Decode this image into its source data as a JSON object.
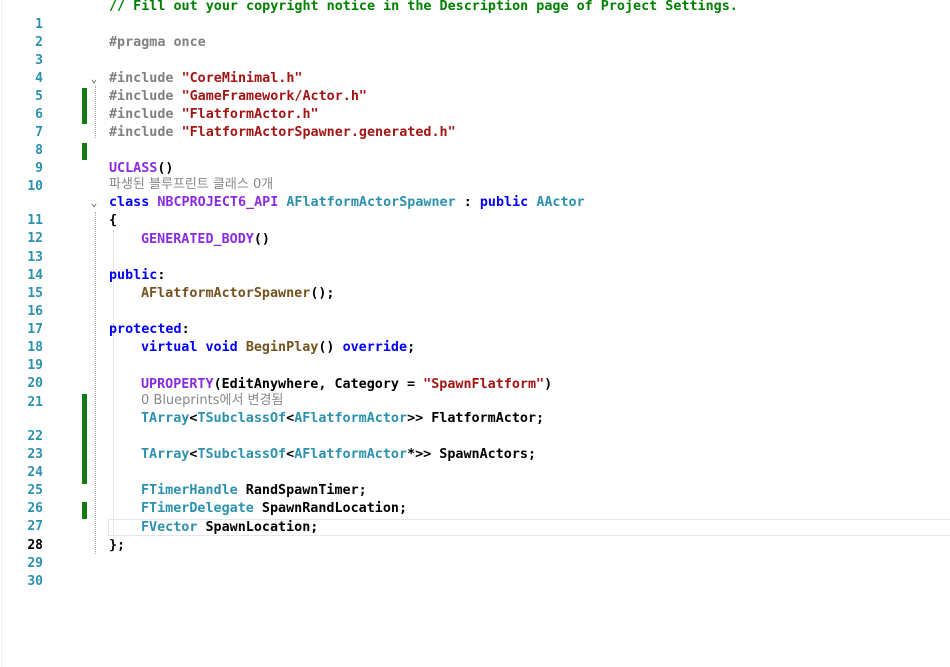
{
  "editor": {
    "lines": [
      {
        "n": "1"
      },
      {
        "n": "2"
      },
      {
        "n": "3"
      },
      {
        "n": "4"
      },
      {
        "n": "5"
      },
      {
        "n": "6"
      },
      {
        "n": "7"
      },
      {
        "n": "8"
      },
      {
        "n": "9"
      },
      {
        "n": "10"
      },
      {
        "n": "11"
      },
      {
        "n": "12"
      },
      {
        "n": "13"
      },
      {
        "n": "14"
      },
      {
        "n": "15"
      },
      {
        "n": "16"
      },
      {
        "n": "17"
      },
      {
        "n": "18"
      },
      {
        "n": "19"
      },
      {
        "n": "20"
      },
      {
        "n": "21"
      },
      {
        "n": "22"
      },
      {
        "n": "23"
      },
      {
        "n": "24"
      },
      {
        "n": "25"
      },
      {
        "n": "26"
      },
      {
        "n": "27"
      },
      {
        "n": "28"
      },
      {
        "n": "29"
      },
      {
        "n": "30"
      }
    ],
    "code": {
      "l1": "// Fill out your copyright notice in the Description page of Project Settings.",
      "l3": "#pragma once",
      "l5_dir": "#include ",
      "l5_str": "\"CoreMinimal.h\"",
      "l6_dir": "#include ",
      "l6_str": "\"GameFramework/Actor.h\"",
      "l7_dir": "#include ",
      "l7_str": "\"FlatformActor.h\"",
      "l8_dir": "#include ",
      "l8_str": "\"FlatformActorSpawner.generated.h\"",
      "l10_mac": "UCLASS",
      "l10_p": "()",
      "hint10": "파생된 블루프린트 클래스 0개",
      "l11_kw": "class ",
      "l11_api": "NBCPROJECT6_API ",
      "l11_type": "AFlatformActorSpawner",
      "l11_colon": " : ",
      "l11_pub": "public ",
      "l11_base": "AActor",
      "l12": "{",
      "l13_mac": "GENERATED_BODY",
      "l13_p": "()",
      "l15_kw": "public",
      "l15_c": ":",
      "l16_fn": "AFlatformActorSpawner",
      "l16_p": "();",
      "l18_kw": "protected",
      "l18_c": ":",
      "l19_kw1": "virtual ",
      "l19_kw2": "void ",
      "l19_fn": "BeginPlay",
      "l19_p": "() ",
      "l19_kw3": "override",
      "l19_s": ";",
      "l21_mac": "UPROPERTY",
      "l21_a": "(EditAnywhere, Category = ",
      "l21_str": "\"SpawnFlatform\"",
      "l21_b": ")",
      "hint21": "0 Blueprints에서 변경됨",
      "l22_t1": "TArray",
      "l22_a": "<",
      "l22_t2": "TSubclassOf",
      "l22_b": "<",
      "l22_t3": "AFlatformActor",
      "l22_c": ">> FlatformActor;",
      "l24_t1": "TArray",
      "l24_a": "<",
      "l24_t2": "TSubclassOf",
      "l24_b": "<",
      "l24_t3": "AFlatformActor",
      "l24_c": "*>> SpawnActors;",
      "l26_t": "FTimerHandle",
      "l26_r": " RandSpawnTimer;",
      "l27_t": "FTimerDelegate",
      "l27_r": " SpawnRandLocation;",
      "l28_t": "FVector",
      "l28_r": " SpawnLocation;",
      "l29": "};"
    }
  },
  "colors": {
    "comment": "#008000",
    "preprocessor": "#808080",
    "string": "#a31515",
    "keyword": "#0000ff",
    "macro": "#8a2be2",
    "type": "#2b91af",
    "function": "#74531f",
    "line_number": "#2b91af",
    "change_bar": "#107c10"
  }
}
